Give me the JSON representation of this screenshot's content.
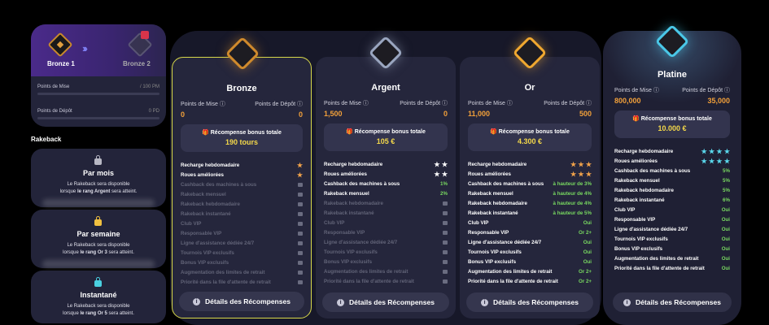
{
  "progress": {
    "current_rank": "Bronze 1",
    "next_rank": "Bronze 2",
    "chevrons": "›››",
    "mise_label": "Points de Mise",
    "mise_value": "/ 100 PM",
    "depot_label": "Points de Dépôt",
    "depot_value": "0 PD"
  },
  "rakeback": {
    "title": "Rakeback",
    "cards": [
      {
        "title": "Par mois",
        "line1": "Le Rakeback sera disponible",
        "line2_pre": "lorsque ",
        "line2_bold": "le rang Argent",
        "line2_post": " sera atteint.",
        "lock_color": "grey"
      },
      {
        "title": "Par semaine",
        "line1": "Le Rakeback sera disponible",
        "line2_pre": "lorsque ",
        "line2_bold": "le rang Or 3",
        "line2_post": " sera atteint.",
        "lock_color": "yellow"
      },
      {
        "title": "Instantané",
        "line1": "Le Rakeback sera disponible",
        "line2_pre": "lorsque ",
        "line2_bold": "le rang Or 5",
        "line2_post": " sera atteint.",
        "lock_color": "cyan"
      }
    ]
  },
  "labels": {
    "points_mise": "Points de Mise",
    "points_depot": "Points de Dépôt",
    "bonus_title": "Récompense bonus totale",
    "details": "Détails des Récompenses",
    "info": "i"
  },
  "tiers": [
    {
      "name": "Bronze",
      "mise": "0",
      "depot": "0",
      "bonus": "190 tours",
      "features": [
        {
          "label": "Recharge hebdomadaire",
          "value": "★",
          "style": "star",
          "on": true
        },
        {
          "label": "Roues améliorées",
          "value": "★",
          "style": "star",
          "on": true
        },
        {
          "label": "Cashback des machines à sous",
          "value": "",
          "style": "lockg",
          "on": false
        },
        {
          "label": "Rakeback mensuel",
          "value": "",
          "style": "lockg",
          "on": false
        },
        {
          "label": "Rakeback hebdomadaire",
          "value": "",
          "style": "lockg",
          "on": false
        },
        {
          "label": "Rakeback instantané",
          "value": "",
          "style": "lockg",
          "on": false
        },
        {
          "label": "Club VIP",
          "value": "",
          "style": "lockg",
          "on": false
        },
        {
          "label": "Responsable VIP",
          "value": "",
          "style": "lockg",
          "on": false
        },
        {
          "label": "Ligne d'assistance dédiée 24/7",
          "value": "",
          "style": "lockg",
          "on": false
        },
        {
          "label": "Tournois VIP exclusifs",
          "value": "",
          "style": "lockg",
          "on": false
        },
        {
          "label": "Bonus VIP exclusifs",
          "value": "",
          "style": "lockg",
          "on": false
        },
        {
          "label": "Augmentation des limites de retrait",
          "value": "",
          "style": "lockg",
          "on": false
        },
        {
          "label": "Priorité dans la file d'attente de retrait",
          "value": "",
          "style": "lockg",
          "on": false
        }
      ]
    },
    {
      "name": "Argent",
      "mise": "1,500",
      "depot": "0",
      "bonus": "105 €",
      "features": [
        {
          "label": "Recharge hebdomadaire",
          "value": "★ ★",
          "style": "star-w",
          "on": true
        },
        {
          "label": "Roues améliorées",
          "value": "★ ★",
          "style": "star-w",
          "on": true
        },
        {
          "label": "Cashback des machines à sous",
          "value": "1%",
          "style": "green",
          "on": true
        },
        {
          "label": "Rakeback mensuel",
          "value": "2%",
          "style": "green",
          "on": true
        },
        {
          "label": "Rakeback hebdomadaire",
          "value": "",
          "style": "lockg",
          "on": false
        },
        {
          "label": "Rakeback instantané",
          "value": "",
          "style": "lockg",
          "on": false
        },
        {
          "label": "Club VIP",
          "value": "",
          "style": "lockg",
          "on": false
        },
        {
          "label": "Responsable VIP",
          "value": "",
          "style": "lockg",
          "on": false
        },
        {
          "label": "Ligne d'assistance dédiée 24/7",
          "value": "",
          "style": "lockg",
          "on": false
        },
        {
          "label": "Tournois VIP exclusifs",
          "value": "",
          "style": "lockg",
          "on": false
        },
        {
          "label": "Bonus VIP exclusifs",
          "value": "",
          "style": "lockg",
          "on": false
        },
        {
          "label": "Augmentation des limites de retrait",
          "value": "",
          "style": "lockg",
          "on": false
        },
        {
          "label": "Priorité dans la file d'attente de retrait",
          "value": "",
          "style": "lockg",
          "on": false
        }
      ]
    },
    {
      "name": "Or",
      "mise": "11,000",
      "depot": "500",
      "bonus": "4.300 €",
      "features": [
        {
          "label": "Recharge hebdomadaire",
          "value": "★ ★ ★",
          "style": "star",
          "on": true
        },
        {
          "label": "Roues améliorées",
          "value": "★ ★ ★",
          "style": "star",
          "on": true
        },
        {
          "label": "Cashback des machines à sous",
          "value": "à hauteur de 3%",
          "style": "green",
          "on": true
        },
        {
          "label": "Rakeback mensuel",
          "value": "à hauteur de 4%",
          "style": "green",
          "on": true
        },
        {
          "label": "Rakeback hebdomadaire",
          "value": "à hauteur de 4%",
          "style": "green",
          "on": true
        },
        {
          "label": "Rakeback instantané",
          "value": "à hauteur de 5%",
          "style": "green",
          "on": true
        },
        {
          "label": "Club VIP",
          "value": "Oui",
          "style": "green",
          "on": true
        },
        {
          "label": "Responsable VIP",
          "value": "Or 2+",
          "style": "green",
          "on": true
        },
        {
          "label": "Ligne d'assistance dédiée 24/7",
          "value": "Oui",
          "style": "green",
          "on": true
        },
        {
          "label": "Tournois VIP exclusifs",
          "value": "Oui",
          "style": "green",
          "on": true
        },
        {
          "label": "Bonus VIP exclusifs",
          "value": "Oui",
          "style": "green",
          "on": true
        },
        {
          "label": "Augmentation des limites de retrait",
          "value": "Or 2+",
          "style": "green",
          "on": true
        },
        {
          "label": "Priorité dans la file d'attente de retrait",
          "value": "Or 2+",
          "style": "green",
          "on": true
        }
      ]
    },
    {
      "name": "Platine",
      "mise": "800,000",
      "depot": "35,000",
      "bonus": "10.000 €",
      "features": [
        {
          "label": "Recharge hebdomadaire",
          "value": "★ ★ ★ ★",
          "style": "star-c",
          "on": true
        },
        {
          "label": "Roues améliorées",
          "value": "★ ★ ★ ★",
          "style": "star-c",
          "on": true
        },
        {
          "label": "Cashback des machines à sous",
          "value": "5%",
          "style": "green",
          "on": true
        },
        {
          "label": "Rakeback mensuel",
          "value": "5%",
          "style": "green",
          "on": true
        },
        {
          "label": "Rakeback hebdomadaire",
          "value": "5%",
          "style": "green",
          "on": true
        },
        {
          "label": "Rakeback instantané",
          "value": "6%",
          "style": "green",
          "on": true
        },
        {
          "label": "Club VIP",
          "value": "Oui",
          "style": "green",
          "on": true
        },
        {
          "label": "Responsable VIP",
          "value": "Oui",
          "style": "green",
          "on": true
        },
        {
          "label": "Ligne d'assistance dédiée 24/7",
          "value": "Oui",
          "style": "green",
          "on": true
        },
        {
          "label": "Tournois VIP exclusifs",
          "value": "Oui",
          "style": "green",
          "on": true
        },
        {
          "label": "Bonus VIP exclusifs",
          "value": "Oui",
          "style": "green",
          "on": true
        },
        {
          "label": "Augmentation des limites de retrait",
          "value": "Oui",
          "style": "green",
          "on": true
        },
        {
          "label": "Priorité dans la file d'attente de retrait",
          "value": "Oui",
          "style": "green",
          "on": true
        }
      ]
    }
  ],
  "colors": {
    "bronze": "#d08a2c",
    "argent": "#9aa6c0",
    "or": "#f0a830",
    "platine": "#4ac8e8",
    "accent_orange": "#f2a03a",
    "accent_green": "#78d860",
    "bonus_yellow": "#f4d84a"
  }
}
